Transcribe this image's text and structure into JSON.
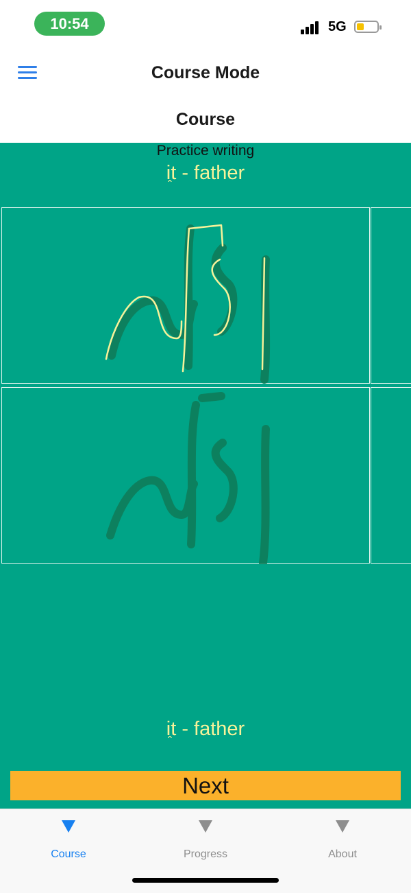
{
  "status": {
    "time": "10:54",
    "network": "5G"
  },
  "header": {
    "title": "Course Mode",
    "subtitle": "Course"
  },
  "lesson": {
    "prompt": "Practice writing",
    "word_top": "it - father",
    "word_bottom": "it - father",
    "next_label": "Next"
  },
  "tabs": [
    {
      "label": "Course",
      "active": true
    },
    {
      "label": "Progress",
      "active": false
    },
    {
      "label": "About",
      "active": false
    }
  ],
  "colors": {
    "accent": "#1780f0",
    "content_bg": "#00a487",
    "button": "#fbb12b",
    "stroke": "#f7f29a"
  }
}
